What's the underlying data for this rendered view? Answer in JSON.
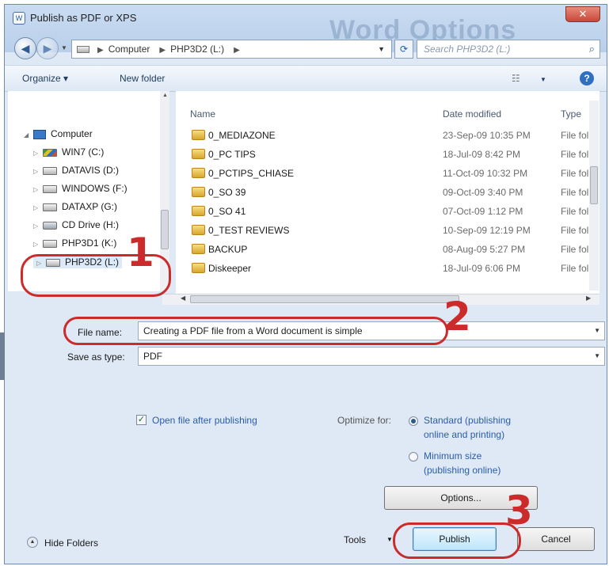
{
  "window": {
    "title": "Publish as PDF or XPS",
    "background_title": "Word Options",
    "close_glyph": "✕",
    "app_icon_text": "W"
  },
  "address_bar": {
    "crumbs": [
      "Computer",
      "PHP3D2 (L:)"
    ],
    "search_placeholder": "Search PHP3D2 (L:)"
  },
  "toolbar": {
    "organize": "Organize ▾",
    "new_folder": "New folder",
    "help": "?"
  },
  "nav_tree": {
    "root": "Computer",
    "drives": [
      "WIN7 (C:)",
      "DATAVIS (D:)",
      "WINDOWS (F:)",
      "DATAXP (G:)",
      "CD Drive (H:)",
      "PHP3D1 (K:)",
      "PHP3D2 (L:)"
    ],
    "selected": "PHP3D2 (L:)"
  },
  "file_list": {
    "columns": {
      "name": "Name",
      "date": "Date modified",
      "type": "Type"
    },
    "rows": [
      {
        "name": "0_MEDIAZONE",
        "date": "23-Sep-09 10:35 PM",
        "type": "File fol"
      },
      {
        "name": "0_PC TIPS",
        "date": "18-Jul-09 8:42 PM",
        "type": "File fol"
      },
      {
        "name": "0_PCTIPS_CHIASE",
        "date": "11-Oct-09 10:32 PM",
        "type": "File fol"
      },
      {
        "name": "0_SO 39",
        "date": "09-Oct-09 3:40 PM",
        "type": "File fol"
      },
      {
        "name": "0_SO 41",
        "date": "07-Oct-09 1:12 PM",
        "type": "File fol"
      },
      {
        "name": "0_TEST REVIEWS",
        "date": "10-Sep-09 12:19 PM",
        "type": "File fol"
      },
      {
        "name": "BACKUP",
        "date": "08-Aug-09 5:27 PM",
        "type": "File fol"
      },
      {
        "name": "Diskeeper",
        "date": "18-Jul-09 6:06 PM",
        "type": "File fol"
      }
    ]
  },
  "form": {
    "file_name_label": "File name:",
    "file_name_value": "Creating a PDF file from a Word document is simple",
    "save_type_label": "Save as type:",
    "save_type_value": "PDF"
  },
  "options": {
    "open_after_label": "Open file after publishing",
    "open_after_checked": true,
    "check_glyph": "✓",
    "optimize_label": "Optimize for:",
    "standard_line1": "Standard (publishing",
    "standard_line2": "online and printing)",
    "minimum_line1": "Minimum size",
    "minimum_line2": "(publishing online)",
    "options_button": "Options..."
  },
  "footer": {
    "hide_folders": "Hide Folders",
    "tools": "Tools",
    "publish": "Publish",
    "cancel": "Cancel"
  },
  "annotations": {
    "step1": "1",
    "step2": "2",
    "step3": "3",
    "color": "#cc2b2b"
  }
}
